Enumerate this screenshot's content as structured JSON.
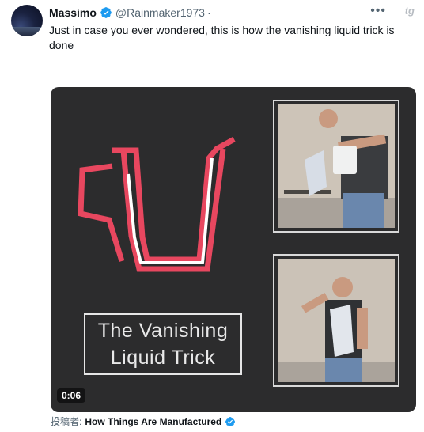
{
  "tweet": {
    "display_name": "Massimo",
    "handle": "@Rainmaker1973",
    "separator": "·",
    "text": "Just in case you ever wondered, this is how the vanishing liquid trick is done",
    "more_icon": "more-horizontal-icon",
    "brand_icon": "tg",
    "verified_color": "#1d9bf0"
  },
  "media": {
    "title_line_1": "The Vanishing",
    "title_line_2": "Liquid Trick",
    "timestamp": "0:06",
    "accent_color": "#e8475f",
    "background_color": "#2c2c2d"
  },
  "credit": {
    "label": "投稿者:",
    "name": "How Things Are Manufactured"
  }
}
